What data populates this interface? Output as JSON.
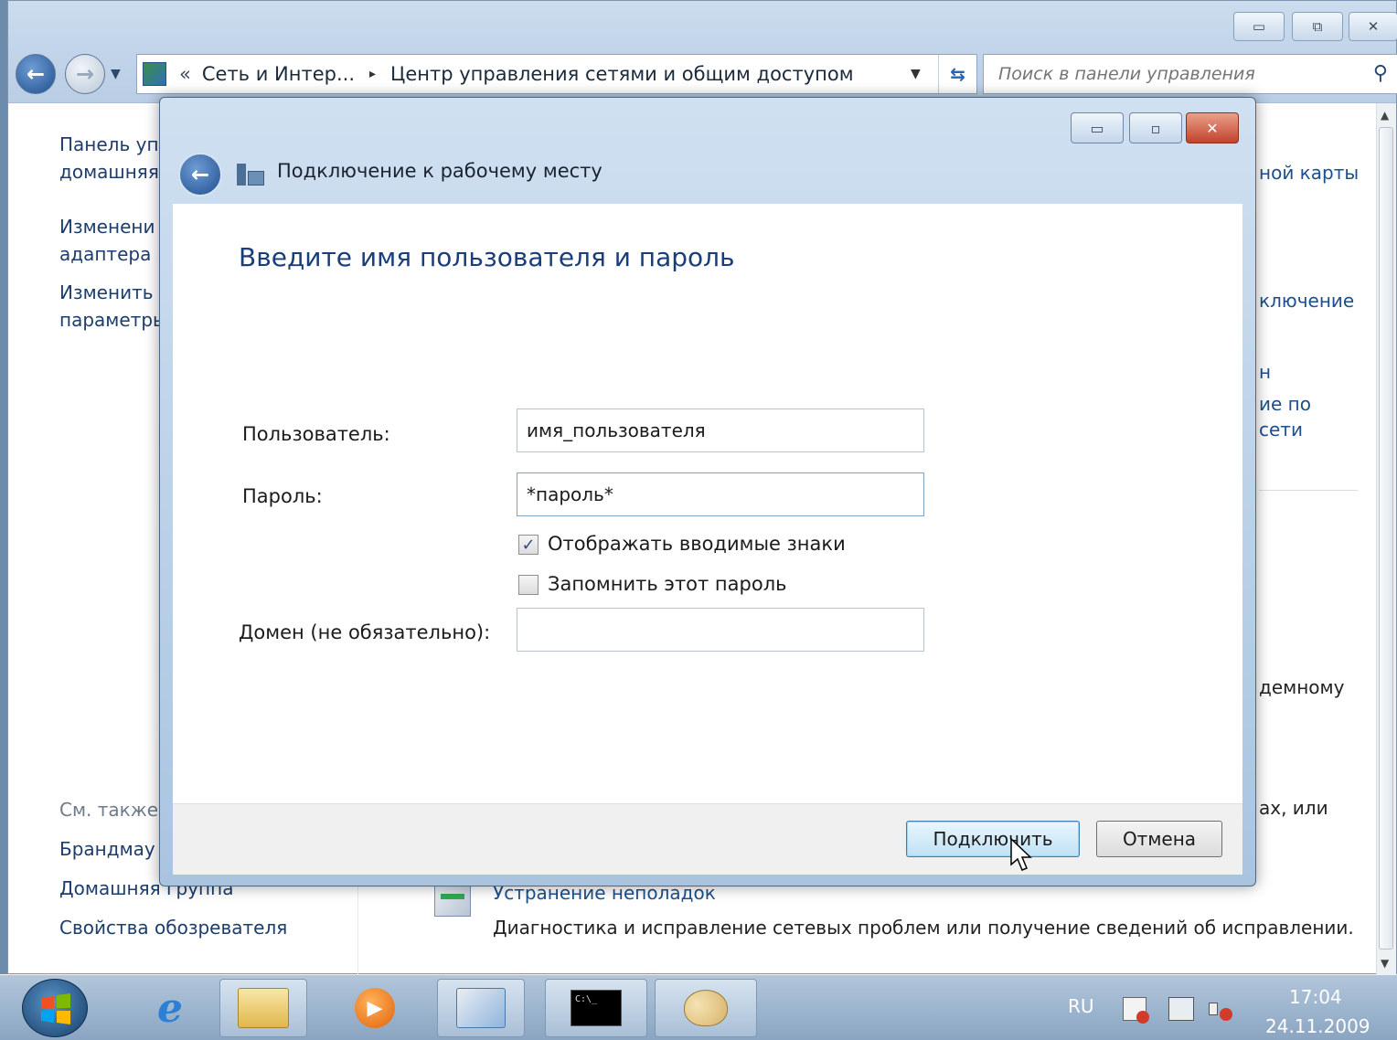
{
  "explorer": {
    "address": {
      "chevrons": "«",
      "crumb1": "Сеть и Интер...",
      "sep": "▸",
      "crumb2": "Центр управления сетями и общим доступом"
    },
    "search": {
      "placeholder": "Поиск в панели управления"
    },
    "left_nav": {
      "home_line1": "Панель уп",
      "home_line2": "домашняя",
      "adapter_line1": "Изменени",
      "adapter_line2": "адаптера",
      "advanced_line1": "Изменить",
      "advanced_line2": "параметры",
      "see_also": "См. также",
      "firewall": "Брандмау",
      "homegroup": "Домашняя группа",
      "browser_props": "Свойства обозревателя"
    },
    "right_fragments": {
      "map": "ной карты",
      "connect": "ключение",
      "h": "н",
      "sharing1": "ие по",
      "sharing2": "сети",
      "modem": "демному",
      "or": "ах, или"
    },
    "troubleshoot": {
      "title": "Устранение неполадок",
      "desc": "Диагностика и исправление сетевых проблем или получение сведений об исправлении."
    }
  },
  "dialog": {
    "title": "Подключение к рабочему месту",
    "heading": "Введите имя пользователя и пароль",
    "user_label": "Пользователь:",
    "user_value": "имя_пользователя",
    "password_label": "Пароль:",
    "password_value": "*пароль*",
    "show_chars_label": "Отображать вводимые знаки",
    "show_chars_checked": true,
    "remember_label": "Запомнить этот пароль",
    "remember_checked": false,
    "domain_label": "Домен (не обязательно):",
    "domain_value": "",
    "connect_button": "Подключить",
    "cancel_button": "Отмена"
  },
  "taskbar": {
    "language": "RU",
    "time": "17:04",
    "date": "24.11.2009"
  },
  "colors": {
    "link": "#1c3d6d",
    "heading": "#1a3e7a",
    "close_red": "#c2432b"
  }
}
